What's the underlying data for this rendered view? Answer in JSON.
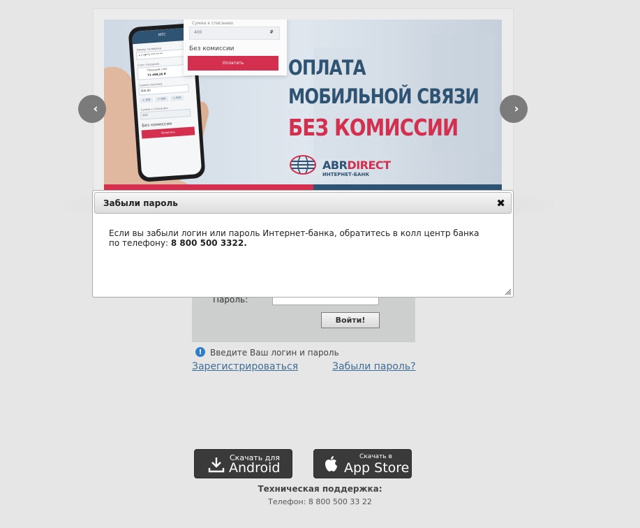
{
  "banner": {
    "headline_line1": "ОПЛАТА",
    "headline_line2": "МОБИЛЬНОЙ СВЯЗИ",
    "headline_line3": "БЕЗ КОМИССИИ",
    "brand_abr": "ABR",
    "brand_direct": "DIRECT",
    "brand_sub": "ИНТЕРНЕТ-БАНК",
    "card_amount_label": "Сумма к списанию",
    "card_amount_value": "400",
    "card_currency": "₽",
    "card_no_fee": "Без комиссии",
    "card_pay_button": "Оплатить",
    "phone_screen_title": "МТС",
    "phone_number_label": "Номер телефона",
    "phone_number_value": "+7 (9**) ***-**-**",
    "phone_account_label": "Счет списания",
    "phone_account_name": "Текущий счёт",
    "phone_account_balance": "71 498,26 ₽",
    "phone_pay_amount_label": "Сумма платежа",
    "phone_pay_amount_value": "400,00",
    "phone_quick1": "+ 100",
    "phone_quick2": "+ 200",
    "phone_quick3": "+ 500",
    "phone_debit_label": "Сумма к списанию",
    "phone_debit_value": "400",
    "phone_no_fee": "Без комиссии",
    "phone_pay_button": "Оплатить"
  },
  "carousel": {
    "prev": "‹",
    "next": "›"
  },
  "login": {
    "password_label": "Пароль:",
    "submit_label": "Войти!",
    "hint": "Введите Ваш логин и пароль",
    "register_link": "Зарегистрироваться",
    "forgot_link": "Забыли пароль?"
  },
  "dialog": {
    "title": "Забыли пароль",
    "close": "✖",
    "body_text": "Если вы забыли логин или пароль Интернет-банка, обратитесь в колл центр банка по телефону: ",
    "body_phone": "8 800 500 3322."
  },
  "apps": {
    "android_small": "Скачать для",
    "android_big": "Android",
    "ios_small": "Скачать в",
    "ios_big": "App Store"
  },
  "support": {
    "title": "Техническая поддержка:",
    "phone": "Телефон: 8 800 500 33 22"
  },
  "colors": {
    "accent_blue": "#2f5373",
    "accent_red": "#d42f4e",
    "link": "#3e6e98"
  }
}
